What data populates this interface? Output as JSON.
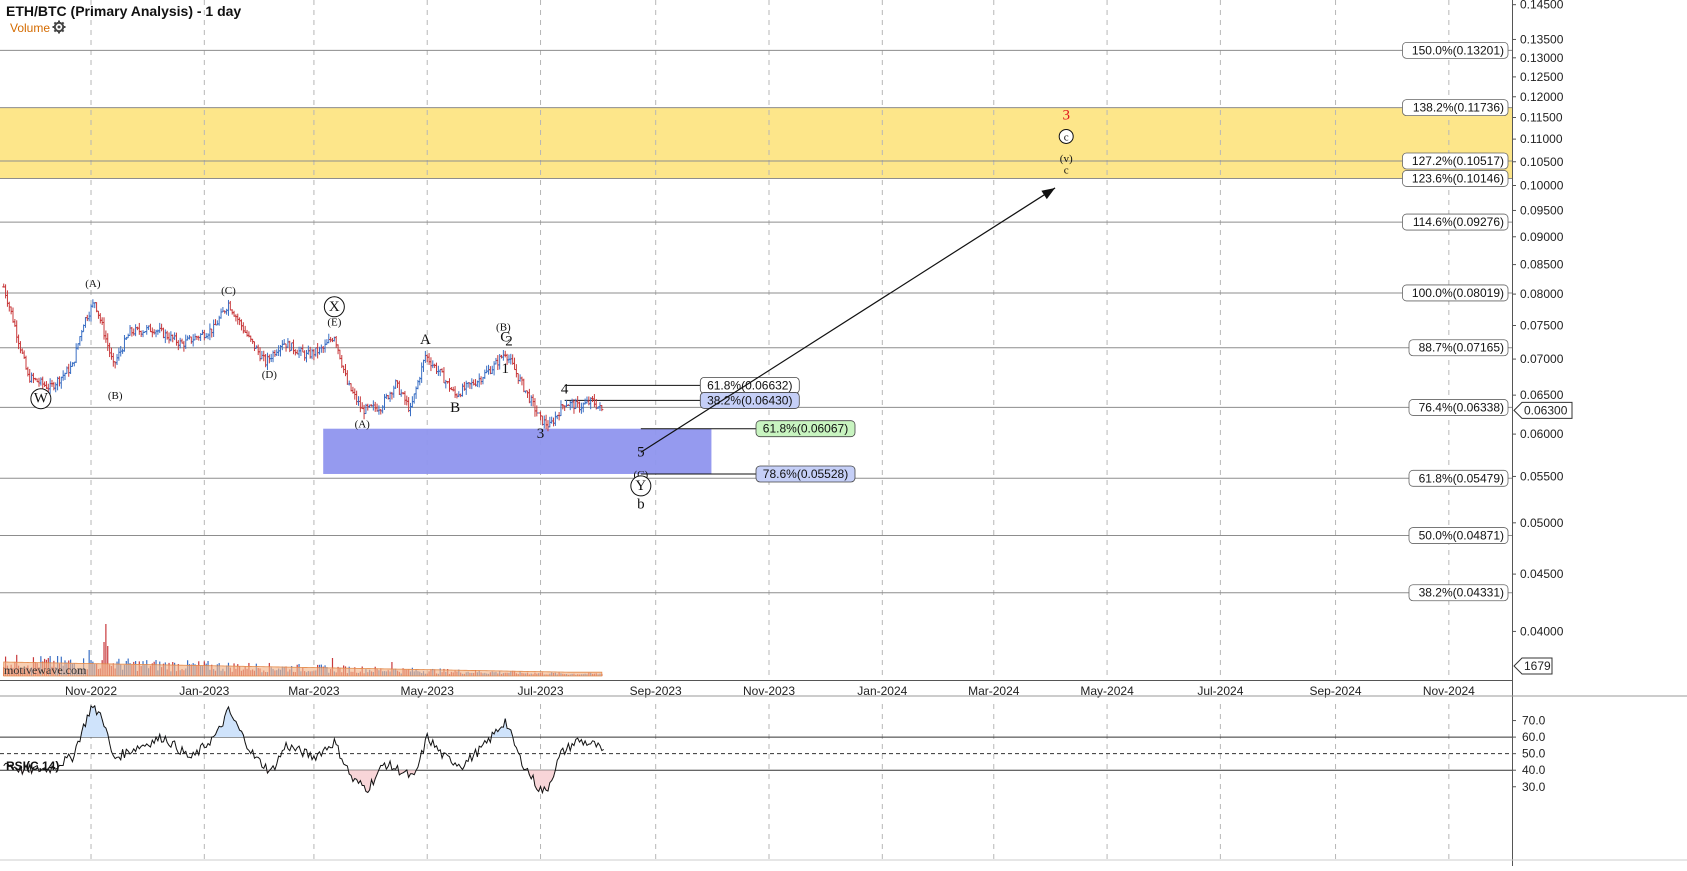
{
  "header": {
    "title": "ETH/BTC (Primary Analysis) - 1 day",
    "volume_label": "Volume",
    "settings_icon": "gear-icon",
    "watermark": "motivewave.com",
    "rsi_title": "RSI(C,14)"
  },
  "colors": {
    "up_bar": "#3a6fc4",
    "down_bar": "#c8393b",
    "yellow_zone": "#fde68a",
    "blue_zone": "#8f95ee",
    "target_red": "#e0141b",
    "volume_ma": "#f3b58a"
  },
  "chart_data": [
    {
      "type": "candlestick",
      "title": "ETH/BTC (Primary Analysis) - 1 day",
      "y_axis": {
        "ylim": [
          0.0362,
          0.1464
        ],
        "ticks": [
          "0.14500",
          "0.13500",
          "0.13000",
          "0.12500",
          "0.12000",
          "0.11500",
          "0.11000",
          "0.10500",
          "0.10000",
          "0.09500",
          "0.09000",
          "0.08500",
          "0.08000",
          "0.07500",
          "0.07000",
          "0.06500",
          "0.06000",
          "0.05500",
          "0.05000",
          "0.04500",
          "0.04000"
        ],
        "current_price": "0.06300",
        "current_volume": "1679"
      },
      "x_axis": {
        "ticks": [
          "Nov-2022",
          "Jan-2023",
          "Mar-2023",
          "May-2023",
          "Jul-2023",
          "Sep-2023",
          "Nov-2023",
          "Jan-2024",
          "Mar-2024",
          "May-2024",
          "Jul-2024",
          "Sep-2024",
          "Nov-2024"
        ]
      },
      "price_path": [
        [
          "2022-09-15",
          0.0812
        ],
        [
          "2022-09-28",
          0.0675
        ],
        [
          "2022-10-10",
          0.066
        ],
        [
          "2022-10-22",
          0.069
        ],
        [
          "2022-10-28",
          0.0755
        ],
        [
          "2022-11-03",
          0.0788
        ],
        [
          "2022-11-10",
          0.072
        ],
        [
          "2022-11-13",
          0.069
        ],
        [
          "2022-11-22",
          0.074
        ],
        [
          "2022-12-05",
          0.0745
        ],
        [
          "2022-12-20",
          0.0722
        ],
        [
          "2023-01-06",
          0.0745
        ],
        [
          "2023-01-14",
          0.0785
        ],
        [
          "2023-01-25",
          0.073
        ],
        [
          "2023-02-03",
          0.0695
        ],
        [
          "2023-02-12",
          0.0725
        ],
        [
          "2023-02-25",
          0.0705
        ],
        [
          "2023-03-06",
          0.0715
        ],
        [
          "2023-03-12",
          0.0735
        ],
        [
          "2023-03-19",
          0.0665
        ],
        [
          "2023-03-27",
          0.063
        ],
        [
          "2023-04-06",
          0.0635
        ],
        [
          "2023-04-14",
          0.0665
        ],
        [
          "2023-04-22",
          0.063
        ],
        [
          "2023-04-30",
          0.0705
        ],
        [
          "2023-05-08",
          0.068
        ],
        [
          "2023-05-16",
          0.065
        ],
        [
          "2023-05-28",
          0.067
        ],
        [
          "2023-06-06",
          0.069
        ],
        [
          "2023-06-12",
          0.071
        ],
        [
          "2023-06-21",
          0.0665
        ],
        [
          "2023-07-01",
          0.0618
        ],
        [
          "2023-07-06",
          0.061
        ],
        [
          "2023-07-14",
          0.064
        ],
        [
          "2023-07-22",
          0.0635
        ],
        [
          "2023-07-29",
          0.0642
        ],
        [
          "2023-08-03",
          0.063
        ]
      ],
      "fibonacci_levels": [
        {
          "label": "150.0%(0.13201)",
          "value": 0.13201
        },
        {
          "label": "138.2%(0.11736)",
          "value": 0.11736
        },
        {
          "label": "127.2%(0.10517)",
          "value": 0.10517
        },
        {
          "label": "123.6%(0.10146)",
          "value": 0.10146
        },
        {
          "label": "114.6%(0.09276)",
          "value": 0.09276
        },
        {
          "label": "100.0%(0.08019)",
          "value": 0.08019
        },
        {
          "label": "88.7%(0.07165)",
          "value": 0.07165
        },
        {
          "label": "76.4%(0.06338)",
          "value": 0.06338
        },
        {
          "label": "61.8%(0.05479)",
          "value": 0.05479
        },
        {
          "label": "50.0%(0.04871)",
          "value": 0.04871
        },
        {
          "label": "38.2%(0.04331)",
          "value": 0.04331
        }
      ],
      "retracement_levels": [
        {
          "label": "61.8%(0.06632)",
          "value": 0.06632
        },
        {
          "label": "38.2%(0.06430)",
          "value": 0.0643
        },
        {
          "label": "61.8%(0.06067)",
          "value": 0.06067
        },
        {
          "label": "78.6%(0.05528)",
          "value": 0.05528
        }
      ],
      "zones": [
        {
          "name": "target",
          "from": 0.10146,
          "to": 0.11736
        },
        {
          "name": "support",
          "from": 0.05528,
          "to": 0.06067,
          "start": "2023-03-06",
          "end": "2023-10-01"
        }
      ],
      "wave_labels": [
        {
          "text": "W",
          "circled": true,
          "date": "2022-10-05",
          "price": 0.064
        },
        {
          "text": "(A)",
          "circled": false,
          "date": "2022-11-02",
          "price": 0.0812
        },
        {
          "text": "(B)",
          "circled": false,
          "date": "2022-11-14",
          "price": 0.0645
        },
        {
          "text": "(C)",
          "circled": false,
          "date": "2023-01-14",
          "price": 0.08
        },
        {
          "text": "(D)",
          "circled": false,
          "date": "2023-02-05",
          "price": 0.0673
        },
        {
          "text": "X",
          "circled": true,
          "date": "2023-03-12",
          "price": 0.0773
        },
        {
          "text": "(E)",
          "circled": false,
          "date": "2023-03-12",
          "price": 0.075
        },
        {
          "text": "(A)",
          "circled": false,
          "date": "2023-03-27",
          "price": 0.0608
        },
        {
          "text": "A",
          "circled": false,
          "date": "2023-04-30",
          "price": 0.0722
        },
        {
          "text": "B",
          "circled": false,
          "date": "2023-05-16",
          "price": 0.0628
        },
        {
          "text": "(B)",
          "circled": false,
          "date": "2023-06-11",
          "price": 0.0742
        },
        {
          "text": "C",
          "circled": false,
          "date": "2023-06-12",
          "price": 0.0726
        },
        {
          "text": "2",
          "circled": false,
          "date": "2023-06-14",
          "price": 0.072
        },
        {
          "text": "1",
          "circled": false,
          "date": "2023-06-12",
          "price": 0.068
        },
        {
          "text": "3",
          "circled": false,
          "date": "2023-07-01",
          "price": 0.0595
        },
        {
          "text": "4",
          "circled": false,
          "date": "2023-07-14",
          "price": 0.0652
        },
        {
          "text": "5",
          "circled": false,
          "date": "2023-08-24",
          "price": 0.0573
        },
        {
          "text": "(C)",
          "circled": false,
          "date": "2023-08-24",
          "price": 0.0548
        },
        {
          "text": "Y",
          "circled": true,
          "date": "2023-08-24",
          "price": 0.0535
        },
        {
          "text": "b",
          "circled": false,
          "date": "2023-08-24",
          "price": 0.0515
        },
        {
          "text": "3",
          "circled": false,
          "date": "2024-04-09",
          "price": 0.1145
        },
        {
          "text": "c",
          "circled": true,
          "date": "2024-04-09",
          "price": 0.1097
        },
        {
          "text": "(v)",
          "circled": false,
          "date": "2024-04-09",
          "price": 0.105
        },
        {
          "text": "c",
          "circled": false,
          "date": "2024-04-09",
          "price": 0.1025
        }
      ],
      "projection": {
        "from_date": "2023-08-24",
        "from_price": 0.0578,
        "to_date": "2024-04-03",
        "to_price": 0.0995
      }
    },
    {
      "type": "bar",
      "title": "Volume",
      "note": "volume histogram beneath price bars"
    },
    {
      "type": "line",
      "title": "RSI(C,14)",
      "ylim": [
        22,
        80
      ],
      "ticks": [
        "70.0",
        "60.0",
        "50.0",
        "40.0",
        "30.0"
      ],
      "levels": {
        "overbought": 60,
        "mid": 50,
        "oversold": 40
      },
      "rsi_path": [
        [
          "2022-09-15",
          45
        ],
        [
          "2022-09-25",
          40
        ],
        [
          "2022-10-10",
          41
        ],
        [
          "2022-10-22",
          48
        ],
        [
          "2022-11-01",
          78
        ],
        [
          "2022-11-07",
          73
        ],
        [
          "2022-11-13",
          47
        ],
        [
          "2022-11-24",
          53
        ],
        [
          "2022-12-10",
          60
        ],
        [
          "2022-12-25",
          47
        ],
        [
          "2023-01-08",
          62
        ],
        [
          "2023-01-14",
          76
        ],
        [
          "2023-01-28",
          48
        ],
        [
          "2023-02-06",
          39
        ],
        [
          "2023-02-14",
          55
        ],
        [
          "2023-03-01",
          48
        ],
        [
          "2023-03-12",
          57
        ],
        [
          "2023-03-22",
          34
        ],
        [
          "2023-03-30",
          29
        ],
        [
          "2023-04-08",
          44
        ],
        [
          "2023-04-16",
          40
        ],
        [
          "2023-04-24",
          35
        ],
        [
          "2023-05-01",
          60
        ],
        [
          "2023-05-10",
          48
        ],
        [
          "2023-05-20",
          43
        ],
        [
          "2023-06-01",
          55
        ],
        [
          "2023-06-12",
          70
        ],
        [
          "2023-06-20",
          47
        ],
        [
          "2023-06-30",
          29
        ],
        [
          "2023-07-04",
          27
        ],
        [
          "2023-07-12",
          50
        ],
        [
          "2023-07-21",
          58
        ],
        [
          "2023-07-31",
          55
        ],
        [
          "2023-08-04",
          50
        ]
      ]
    }
  ]
}
